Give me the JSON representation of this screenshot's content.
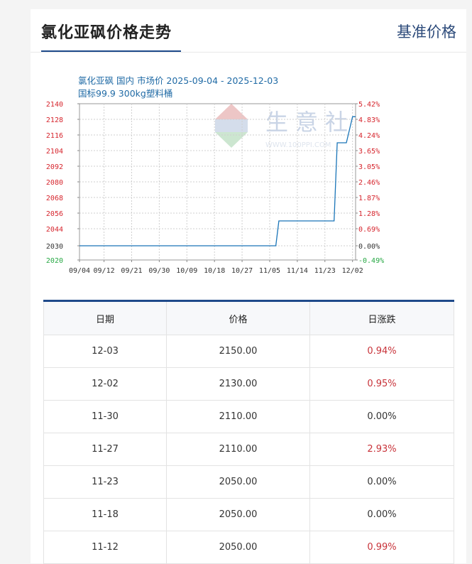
{
  "header": {
    "title": "氯化亚砜价格走势",
    "link_label": "基准价格"
  },
  "chart_data": {
    "type": "line",
    "title": "氯化亚砜 国内 市场价 2025-09-04 - 2025-12-03",
    "subtitle": "国标99.9  300kg塑料桶",
    "x_ticks": [
      "09/04",
      "09/12",
      "09/21",
      "09/30",
      "10/09",
      "10/18",
      "10/27",
      "11/05",
      "11/14",
      "11/23",
      "12/02"
    ],
    "y_ticks": [
      2140,
      2128,
      2116,
      2104,
      2092,
      2080,
      2068,
      2056,
      2044,
      2030,
      2020
    ],
    "y2_ticks": [
      "5.42%",
      "4.83%",
      "4.24%",
      "3.65%",
      "3.05%",
      "2.46%",
      "1.87%",
      "1.28%",
      "0.69%",
      "0.00%",
      "-0.49%"
    ],
    "ylim": [
      2020,
      2140
    ],
    "series": [
      {
        "points": [
          [
            "09/04",
            2030
          ],
          [
            "11/07",
            2030
          ],
          [
            "11/08",
            2050
          ],
          [
            "11/26",
            2050
          ],
          [
            "11/27",
            2110
          ],
          [
            "11/30",
            2110
          ],
          [
            "12/02",
            2130
          ],
          [
            "12/03",
            2130
          ]
        ]
      }
    ],
    "watermark": "生意社",
    "watermark_sub": "WWW.100PPI.COM",
    "colors": {
      "line": "#1a75b8",
      "left_axis": "#d6252d",
      "right_axis_pos": "#d6252d",
      "right_axis_neg": "#27a844",
      "title": "#1f6aa5"
    }
  },
  "table": {
    "headers": [
      "日期",
      "价格",
      "日涨跌"
    ],
    "rows": [
      {
        "date": "12-03",
        "price": "2150.00",
        "change": "0.94%"
      },
      {
        "date": "12-02",
        "price": "2130.00",
        "change": "0.95%"
      },
      {
        "date": "11-30",
        "price": "2110.00",
        "change": "0.00%"
      },
      {
        "date": "11-27",
        "price": "2110.00",
        "change": "2.93%"
      },
      {
        "date": "11-23",
        "price": "2050.00",
        "change": "0.00%"
      },
      {
        "date": "11-18",
        "price": "2050.00",
        "change": "0.00%"
      },
      {
        "date": "11-12",
        "price": "2050.00",
        "change": "0.99%"
      }
    ]
  }
}
